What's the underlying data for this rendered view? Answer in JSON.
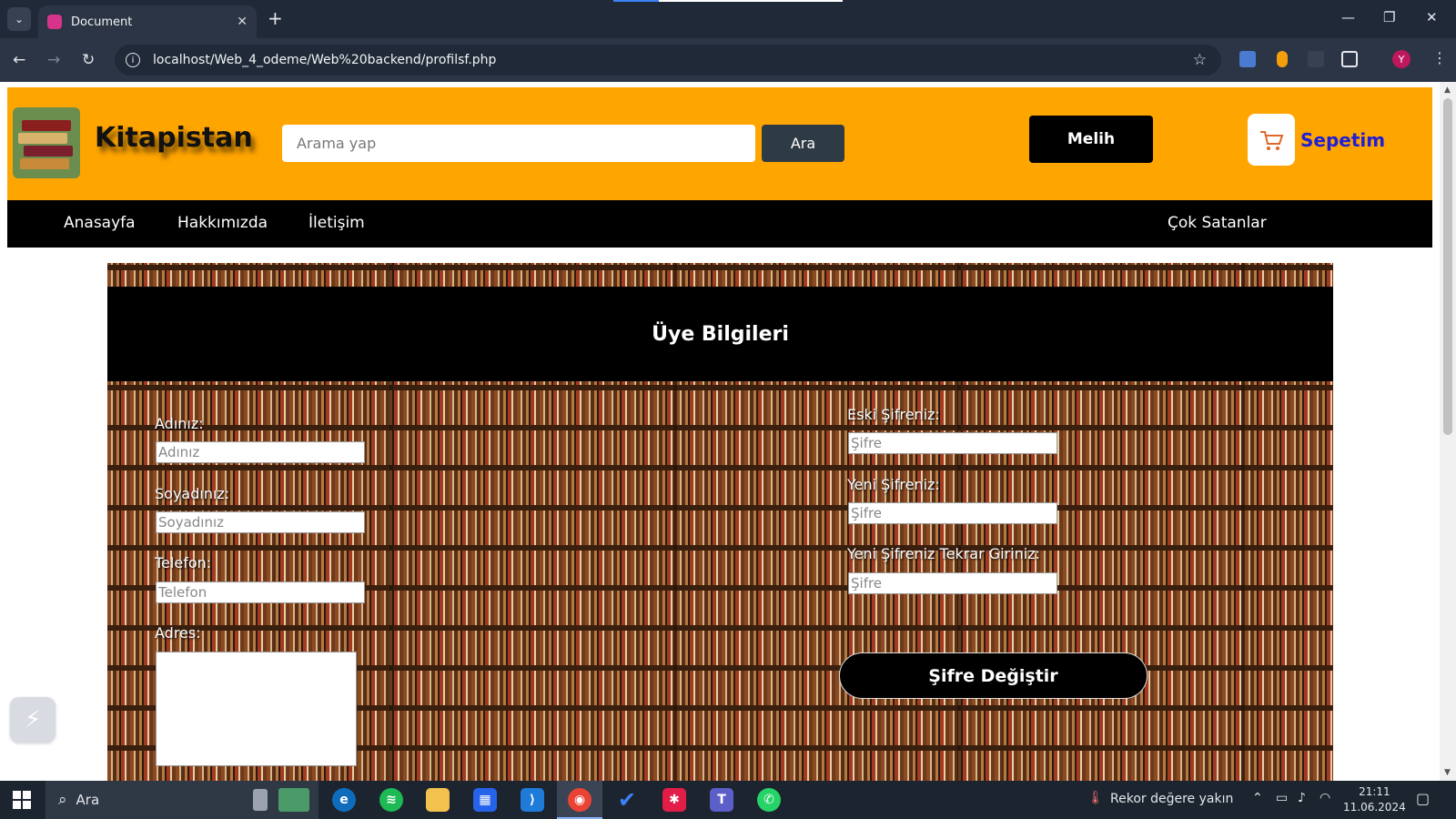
{
  "browser": {
    "tab_title": "Document",
    "tab_close": "✕",
    "new_tab": "+",
    "url": "localhost/Web_4_odeme/Web%20backend/profilsf.php",
    "win_minimize": "—",
    "win_restore": "❐",
    "win_close": "✕",
    "profile_initial": "Y"
  },
  "site": {
    "brand": "Kitapistan",
    "search_placeholder": "Arama yap",
    "search_button": "Ara",
    "user_button": "Melih",
    "cart_label": "Sepetim",
    "nav": {
      "home": "Anasayfa",
      "about": "Hakkımızda",
      "contact": "İletişim",
      "bestsellers": "Çok Satanlar"
    }
  },
  "profile": {
    "title": "Üye Bilgileri",
    "name_label": "Adınız:",
    "name_placeholder": "Adınız",
    "surname_label": "Soyadınız:",
    "surname_placeholder": "Soyadınız",
    "phone_label": "Telefon:",
    "phone_placeholder": "Telefon",
    "address_label": "Adres:",
    "old_password_label": "Eski Şifreniz:",
    "new_password_label": "Yeni Şifreniz:",
    "repeat_password_label": "Yeni Şifreniz Tekrar Giriniz:",
    "password_placeholder": "Şifre",
    "change_button": "Şifre Değiştir"
  },
  "taskbar": {
    "search_label": "Ara",
    "weather_text": "Rekor değere yakın",
    "time": "21:11",
    "date": "11.06.2024"
  },
  "colors": {
    "header_bg": "#ffa500",
    "nav_bg": "#000000",
    "cart_text": "#1f1fd6"
  }
}
